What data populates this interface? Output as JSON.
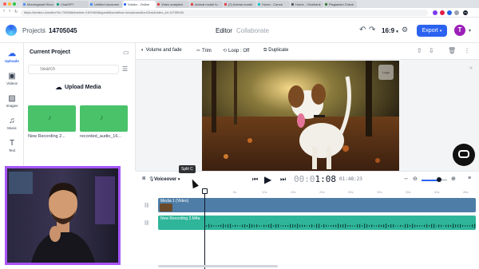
{
  "browser": {
    "tabs": [
      {
        "title": "Morningstart Reco",
        "active": false,
        "color": "#4b8df8"
      },
      {
        "title": "ChatGPT",
        "active": false,
        "color": "#10a37f"
      },
      {
        "title": "Untitled documen",
        "active": false,
        "color": "#4285f4"
      },
      {
        "title": "Voidez - Online",
        "active": true,
        "color": "#2b63f0"
      },
      {
        "title": "Video analytics",
        "active": false,
        "color": "#e23c3c"
      },
      {
        "title": "Animal model fu",
        "active": false,
        "color": "#e23c3c"
      },
      {
        "title": "(2) Animal model",
        "active": false,
        "color": "#e23c3c"
      },
      {
        "title": "Home - Canva",
        "active": false,
        "color": "#00c4cc"
      },
      {
        "title": "Home - Clickbank",
        "active": false,
        "color": "#555555"
      },
      {
        "title": "Plagiarism Check",
        "active": false,
        "color": "#2e7d32"
      }
    ],
    "url": "https://invideo.io/editor?id=70458&timeline=16%3A9&typeall&workflow=storyboard&onClick&video_id=14705045"
  },
  "header": {
    "projects_label": "Projects",
    "separator": "/",
    "project_id": "14705045",
    "editor_tab": "Editor",
    "collaborate_tab": "Collaborate",
    "aspect_ratio": "16:9",
    "export_label": "Export",
    "export_caret": "▾",
    "avatar_initial": "T",
    "accent": "#2b63f0",
    "avatar_color": "#9b1fb8"
  },
  "rail": {
    "items": [
      {
        "label": "Uploads",
        "icon": "cloud-upload-icon",
        "glyph": "☁",
        "active": true
      },
      {
        "label": "Videos",
        "icon": "video-icon",
        "glyph": "▣",
        "active": false
      },
      {
        "label": "Images",
        "icon": "image-icon",
        "glyph": "▨",
        "active": false
      },
      {
        "label": "Music",
        "icon": "music-icon",
        "glyph": "♫",
        "active": false
      },
      {
        "label": "Text",
        "icon": "text-icon",
        "glyph": "T",
        "active": false
      }
    ]
  },
  "panel": {
    "title": "Current Project",
    "search_placeholder": "Search",
    "upload_label": "Upload Media",
    "clips": [
      {
        "name": "New Recording 2..."
      },
      {
        "name": "recorded_audio_16..."
      }
    ],
    "clip_color": "#49c26a"
  },
  "toolbar": {
    "volume_fade": "Volume and fade",
    "trim": "Trim",
    "loop": "Loop : Off",
    "duplicate": "Duplicate"
  },
  "video": {
    "mini_label": "Logo"
  },
  "timeline": {
    "tooltip": "Split  C",
    "voiceover_label": "Voiceover",
    "timecode_prefix": "00:0",
    "timecode_main": "1:08",
    "total_time": "01:48:23",
    "zoom_level": 0.7,
    "ticks": [
      "0s",
      "5s",
      "10s",
      "15s",
      "20s",
      "25s",
      "30s",
      "35s",
      "40s",
      "45s"
    ],
    "video_track_label": "Media 1 (Video)",
    "audio_track_label": "New Recording 2.M4a",
    "video_track_color": "#4e7ea7",
    "audio_track_color": "#2fb59a"
  }
}
